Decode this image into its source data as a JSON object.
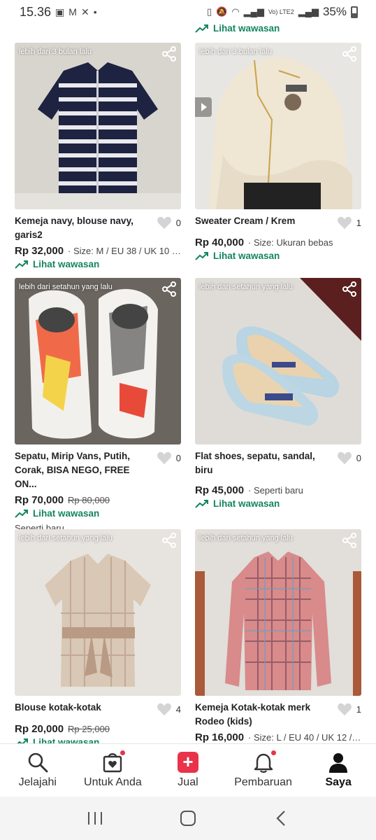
{
  "status_bar": {
    "time": "15.36",
    "battery": "35%",
    "lte": "Vo) LTE2"
  },
  "insight_label": "Lihat wawasan",
  "cards": [
    {
      "timestamp": "lebih dari 3 bulan lalu",
      "title": "Kemeja navy, blouse navy, garis2",
      "likes": "0",
      "price": "Rp 32,000",
      "old_price": "",
      "meta": "· Size: M / EU 38 / UK 10 / ...",
      "condition": "",
      "image": "striped-navy-blouse"
    },
    {
      "timestamp": "lebih dari 3 bulan lalu",
      "title": "Sweater Cream / Krem",
      "likes": "1",
      "price": "Rp 40,000",
      "old_price": "",
      "meta": "· Size: Ukuran bebas",
      "condition": "",
      "image": "cream-sweater"
    },
    {
      "timestamp": "lebih dari setahun yang lalu",
      "title": "Sepatu, Mirip Vans, Putih, Corak, BISA NEGO, FREE ON...",
      "likes": "0",
      "price": "Rp 70,000",
      "old_price": "Rp 80,000",
      "meta": "",
      "condition": "Seperti baru",
      "image": "printed-slip-on-shoes"
    },
    {
      "timestamp": "lebih dari setahun yang lalu",
      "title": "Flat shoes, sepatu, sandal, biru",
      "likes": "0",
      "price": "Rp 45,000",
      "old_price": "",
      "meta": "· Seperti baru",
      "condition": "",
      "image": "blue-flat-shoes"
    },
    {
      "timestamp": "lebih dari setahun yang lalu",
      "title": "Blouse kotak-kotak",
      "likes": "4",
      "price": "Rp 20,000",
      "old_price": "Rp 25,000",
      "meta": "",
      "condition": "",
      "image": "plaid-blouse"
    },
    {
      "timestamp": "lebih dari setahun yang lalu",
      "title": "Kemeja Kotak-kotak merk Rodeo (kids)",
      "likes": "1",
      "price": "Rp 16,000",
      "old_price": "",
      "meta": "· Size: L / EU 40 / UK 12 / ...",
      "condition": "",
      "image": "plaid-shirt-red"
    }
  ],
  "bottom_nav": [
    {
      "label": "Jelajahi",
      "icon": "search-icon",
      "badge": false
    },
    {
      "label": "Untuk Anda",
      "icon": "heart-bag-icon",
      "badge": true
    },
    {
      "label": "Jual",
      "icon": "plus-icon",
      "badge": false
    },
    {
      "label": "Pembaruan",
      "icon": "bell-icon",
      "badge": true
    },
    {
      "label": "Saya",
      "icon": "person-icon",
      "badge": false
    }
  ],
  "colors": {
    "accent_green": "#13855f",
    "badge_red": "#e8334a"
  }
}
